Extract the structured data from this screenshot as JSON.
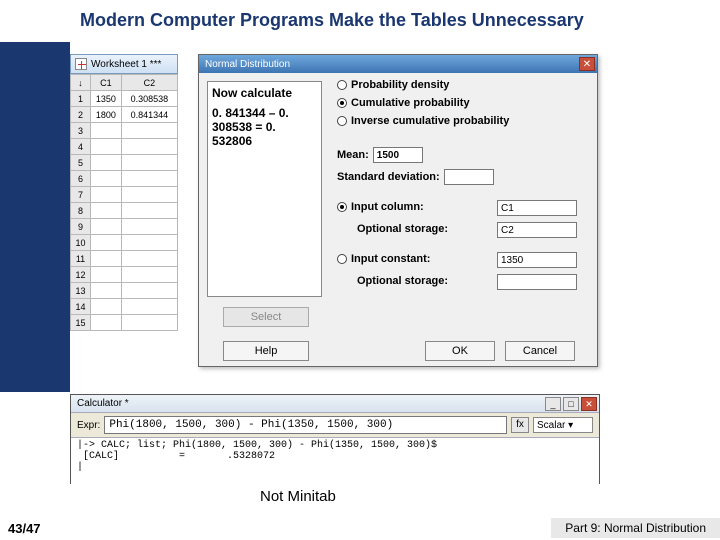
{
  "title": "Modern Computer Programs Make the Tables Unnecessary",
  "worksheet": {
    "caption": "Worksheet 1 ***",
    "columns": [
      "C1",
      "C2"
    ],
    "rows": [
      {
        "n": "1",
        "c1": "1350",
        "c2": "0.308538"
      },
      {
        "n": "2",
        "c1": "1800",
        "c2": "0.841344"
      },
      {
        "n": "3",
        "c1": "",
        "c2": ""
      },
      {
        "n": "4",
        "c1": "",
        "c2": ""
      },
      {
        "n": "5",
        "c1": "",
        "c2": ""
      },
      {
        "n": "6",
        "c1": "",
        "c2": ""
      },
      {
        "n": "7",
        "c1": "",
        "c2": ""
      },
      {
        "n": "8",
        "c1": "",
        "c2": ""
      },
      {
        "n": "9",
        "c1": "",
        "c2": ""
      },
      {
        "n": "10",
        "c1": "",
        "c2": ""
      },
      {
        "n": "11",
        "c1": "",
        "c2": ""
      },
      {
        "n": "12",
        "c1": "",
        "c2": ""
      },
      {
        "n": "13",
        "c1": "",
        "c2": ""
      },
      {
        "n": "14",
        "c1": "",
        "c2": ""
      },
      {
        "n": "15",
        "c1": "",
        "c2": ""
      }
    ]
  },
  "dialog": {
    "title": "Normal Distribution",
    "annot1": "Now calculate",
    "annot2": "0. 841344 – 0. 308538 = 0. 532806",
    "radios": {
      "pd": "Probability density",
      "cp": "Cumulative probability",
      "icp": "Inverse cumulative probability"
    },
    "mean_label": "Mean:",
    "mean_value": "1500",
    "sd_label": "Standard deviation:",
    "sd_value": "",
    "incol_label": "Input column:",
    "incol_value": "C1",
    "store1_label": "Optional storage:",
    "store1_value": "C2",
    "inconst_label": "Input constant:",
    "inconst_value": "1350",
    "store2_label": "Optional storage:",
    "store2_value": "",
    "select": "Select",
    "help": "Help",
    "ok": "OK",
    "cancel": "Cancel"
  },
  "calc": {
    "title": "Calculator *",
    "expr_label": "Expr:",
    "expr": "Phi(1800, 1500, 300) - Phi(1350, 1500, 300)",
    "fx": "fx",
    "scalar": "Scalar ▾",
    "output": "|-> CALC; list; Phi(1800, 1500, 300) - Phi(1350, 1500, 300)$\n [CALC]          =       .5328072\n|"
  },
  "not_minitab": "Not Minitab",
  "footer": {
    "page": "43/47",
    "part": "Part 9: Normal Distribution"
  }
}
